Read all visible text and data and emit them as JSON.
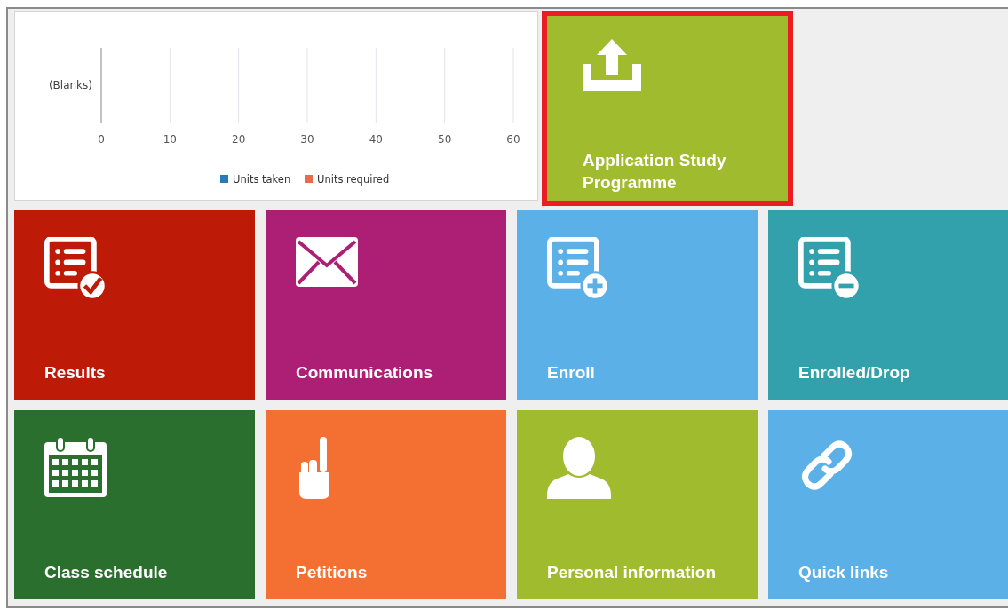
{
  "chart_panel": {
    "chart_data": {
      "type": "bar",
      "orientation": "horizontal",
      "categories": [
        "(Blanks)"
      ],
      "series": [
        {
          "name": "Units taken",
          "color": "#2a7ab8",
          "values": [
            null
          ]
        },
        {
          "name": "Units required",
          "color": "#ec6a4a",
          "values": [
            null
          ]
        }
      ],
      "xlim": [
        0,
        60
      ],
      "grid": true,
      "xticks": [
        0,
        10,
        20,
        30,
        40,
        50,
        60
      ]
    }
  },
  "featured_tile": {
    "label": "Application Study Programme",
    "kind": "upload",
    "color": "#a0bb2e",
    "highlighted": true
  },
  "tiles": [
    {
      "label": "Results",
      "kind": "results",
      "color": "#bd1a08"
    },
    {
      "label": "Communications",
      "kind": "mail",
      "color": "#ad1f75"
    },
    {
      "label": "Enroll",
      "kind": "enroll",
      "color": "#5cb0e8"
    },
    {
      "label": "Enrolled/Drop",
      "kind": "drop",
      "color": "#33a1ab"
    },
    {
      "label": "Class schedule",
      "kind": "calendar",
      "color": "#2b6f2e"
    },
    {
      "label": "Petitions",
      "kind": "hand",
      "color": "#f36f32"
    },
    {
      "label": "Personal information",
      "kind": "person",
      "color": "#a0bb2e"
    },
    {
      "label": "Quick links",
      "kind": "link",
      "color": "#5cb0e8"
    }
  ]
}
